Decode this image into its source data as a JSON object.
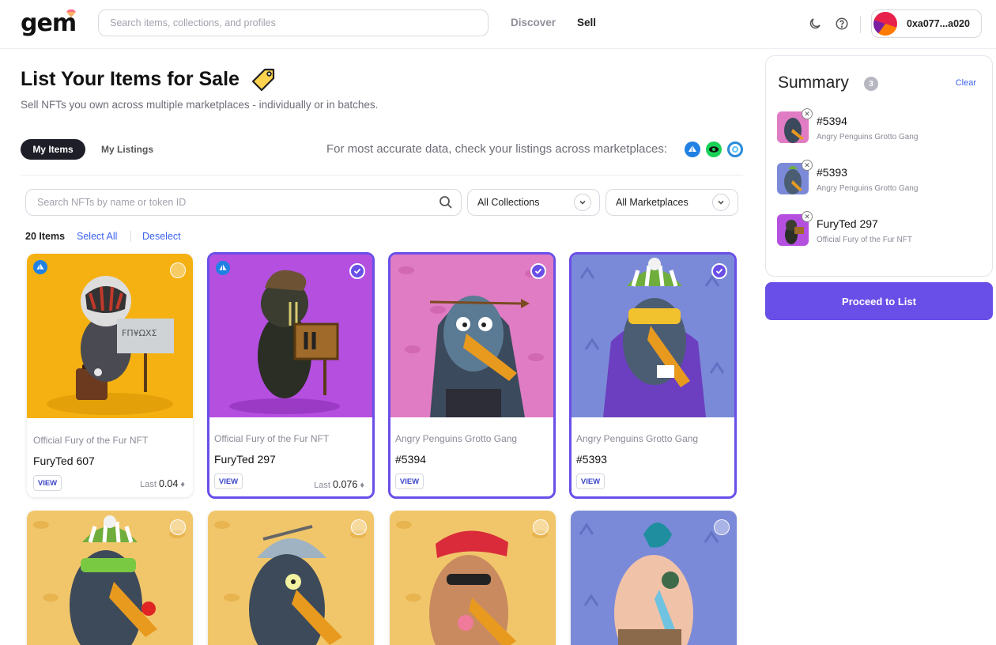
{
  "header": {
    "logo": "gem",
    "search_placeholder": "Search items, collections, and profiles",
    "nav": {
      "discover": "Discover",
      "sell": "Sell"
    },
    "wallet": "0xa077...a020"
  },
  "page": {
    "title": "List Your Items for Sale",
    "subtitle": "Sell NFTs you own across multiple marketplaces - individually or in batches.",
    "tabs": {
      "active": "My Items",
      "other": "My Listings"
    },
    "marketplace_note": "For most accurate data, check your listings across marketplaces:"
  },
  "filters": {
    "search_placeholder": "Search NFTs by name or token ID",
    "collections": "All Collections",
    "marketplaces": "All Marketplaces",
    "count": "20 Items",
    "select_all": "Select All",
    "deselect": "Deselect"
  },
  "cards": [
    {
      "collection": "Official Fury of the Fur NFT",
      "name": "FuryTed 607",
      "view": "VIEW",
      "last_label": "Last",
      "last_value": "0.04",
      "selected": false,
      "bg": "#f5b111"
    },
    {
      "collection": "Official Fury of the Fur NFT",
      "name": "FuryTed 297",
      "view": "VIEW",
      "last_label": "Last",
      "last_value": "0.076",
      "selected": true,
      "bg": "#b44fe0"
    },
    {
      "collection": "Angry Penguins Grotto Gang",
      "name": "#5394",
      "view": "VIEW",
      "selected": true,
      "bg": "#e07cc4"
    },
    {
      "collection": "Angry Penguins Grotto Gang",
      "name": "#5393",
      "view": "VIEW",
      "selected": true,
      "bg": "#7b8ad8"
    },
    {
      "selected": false,
      "bg": "#f1c66a"
    },
    {
      "selected": false,
      "bg": "#f1c66a"
    },
    {
      "selected": false,
      "bg": "#f1c66a"
    },
    {
      "selected": false,
      "bg": "#7b8ad8"
    }
  ],
  "summary": {
    "title": "Summary",
    "count": "3",
    "clear": "Clear",
    "items": [
      {
        "name": "#5394",
        "collection": "Angry Penguins Grotto Gang"
      },
      {
        "name": "#5393",
        "collection": "Angry Penguins Grotto Gang"
      },
      {
        "name": "FuryTed 297",
        "collection": "Official Fury of the Fur NFT"
      }
    ],
    "proceed": "Proceed to List"
  },
  "colors": {
    "accent": "#6a4ee8",
    "link": "#3b63f0",
    "opensea": "#2081e2"
  },
  "icons": [
    "gem-icon",
    "moon-icon",
    "help-icon",
    "tag-icon",
    "search-icon",
    "chevron-down-icon",
    "opensea-icon",
    "looksrare-icon",
    "x2y2-icon",
    "check-icon",
    "close-icon",
    "eth-icon"
  ]
}
